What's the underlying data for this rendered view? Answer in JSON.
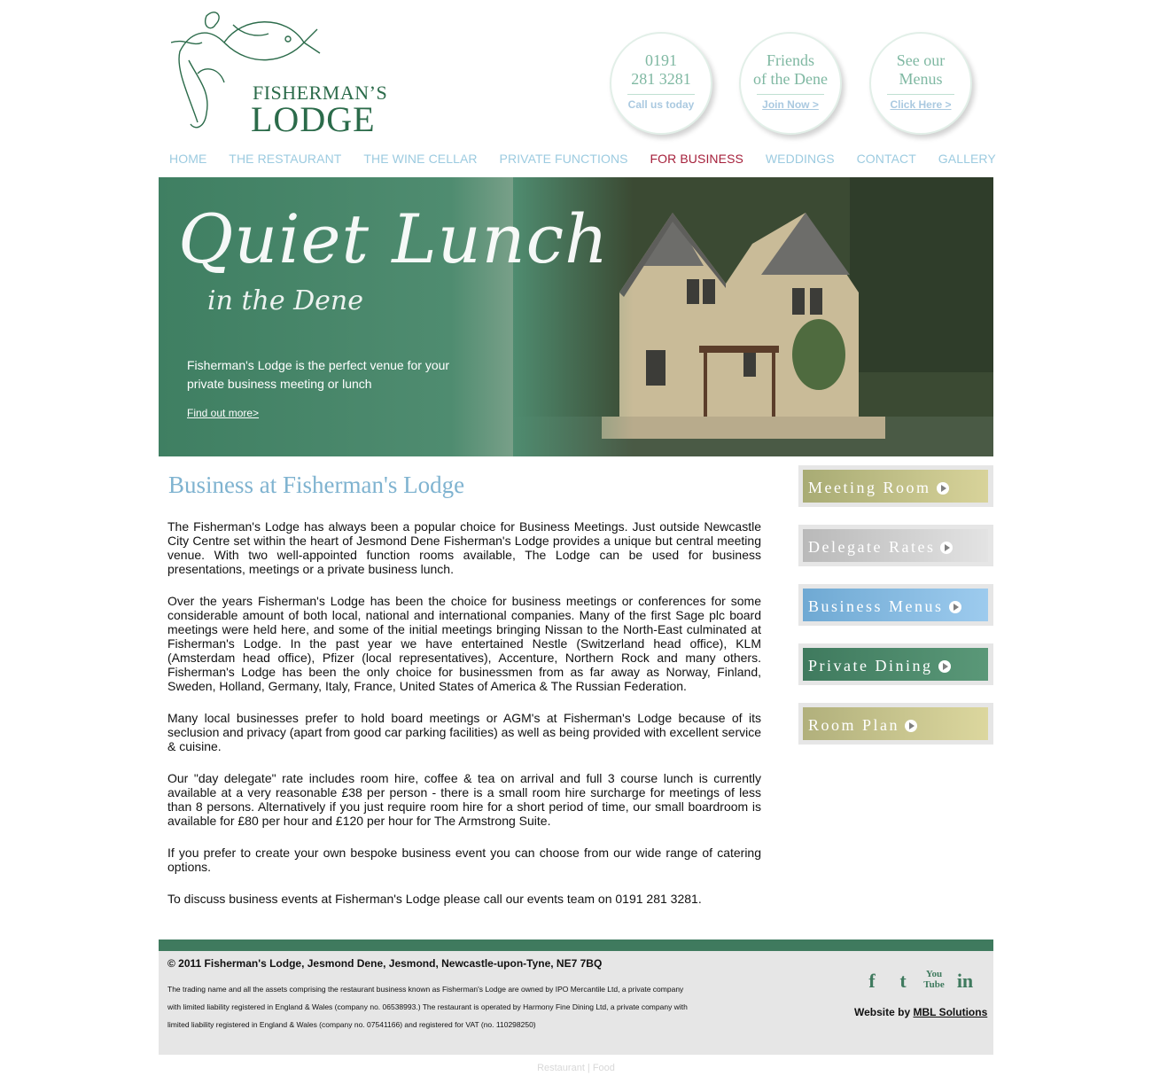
{
  "logo": {
    "line1": "FISHERMAN’S",
    "line2": "LODGE"
  },
  "header_circles": [
    {
      "line1": "0191",
      "line2": "281 3281",
      "action": "Call us today"
    },
    {
      "line1": "Friends",
      "line2": "of the Dene",
      "action": "Join Now >"
    },
    {
      "line1": "See our",
      "line2": "Menus",
      "action": "Click Here >"
    }
  ],
  "nav": [
    "HOME",
    "THE RESTAURANT",
    "THE WINE CELLAR",
    "PRIVATE FUNCTIONS",
    "FOR BUSINESS",
    "WEDDINGS",
    "CONTACT",
    "GALLERY"
  ],
  "banner": {
    "script_title": "Quiet Lunch",
    "script_sub": "in the Dene",
    "text": "Fisherman's Lodge is the perfect venue for your private business meeting or lunch",
    "link": "Find out more>"
  },
  "main": {
    "title": "Business at Fisherman's Lodge",
    "paragraphs": [
      "The Fisherman's Lodge has always been a popular choice for Business Meetings. Just outside Newcastle City Centre set within the heart of Jesmond Dene Fisherman's Lodge provides a unique but central meeting venue. With two well-appointed function rooms available, The Lodge can be used for business presentations, meetings or a private business lunch.",
      "Over the years Fisherman's Lodge has been the choice for business meetings or conferences for some considerable amount of both local, national and international companies.  Many of the first Sage plc board meetings were held here, and some of the initial meetings bringing Nissan to the North-East culminated at Fisherman's Lodge.  In the past year we have entertained Nestle (Switzerland head office), KLM (Amsterdam head office),  Pfizer (local representatives), Accenture, Northern Rock and many others.  Fisherman's Lodge has been the only choice for businessmen from as far away as Norway, Finland, Sweden, Holland,  Germany, Italy, France, United States of America & The Russian Federation.",
      "Many local businesses prefer to hold board meetings or AGM's at Fisherman's Lodge because of its seclusion and privacy (apart from good car parking facilities) as well as being provided with excellent service & cuisine.",
      "Our \"day delegate\" rate includes room hire, coffee & tea on arrival and full 3 course lunch is  currently available at a very reasonable £38 per person  - there is a small room hire surcharge for meetings of less than 8 persons. Alternatively if you just require room hire for a short period of time, our small boardroom is available for £80 per hour and £120 per hour for The Armstrong Suite.",
      "If you prefer to create your own bespoke business event you can choose from our wide range of catering options.",
      "To discuss business events at Fisherman's Lodge please call our events team on 0191 281 3281."
    ]
  },
  "side_buttons": [
    {
      "label": "Meeting Room",
      "color": "#c9c690"
    },
    {
      "label": "Delegate Rates",
      "color": "#cfcfcf"
    },
    {
      "label": "Business Menus",
      "color": "#8fc2e6"
    },
    {
      "label": "Private Dining",
      "color": "#4f8c6c"
    },
    {
      "label": "Room Plan",
      "color": "#cfcc94"
    }
  ],
  "footer": {
    "copyright": "© 2011 Fisherman's Lodge, Jesmond Dene, Jesmond, Newcastle-upon-Tyne, NE7 7BQ",
    "legal": "The trading name and all the assets comprising the restaurant business known as Fisherman's Lodge are owned by IPO Mercantile Ltd, a private company with limited liability registered in England & Wales (company no. 06538993.) The restaurant is operated by Harmony Fine Dining Ltd, a private company with limited liability registered in England & Wales (company no. 07541166) and registered for VAT (no. 110298250)",
    "social": [
      "facebook-icon",
      "twitter-icon",
      "youtube-icon",
      "linkedin-icon"
    ],
    "credit_prefix": "Website by",
    "credit_link": "MBL Solutions",
    "bottom_links": "Restaurant | Food"
  }
}
